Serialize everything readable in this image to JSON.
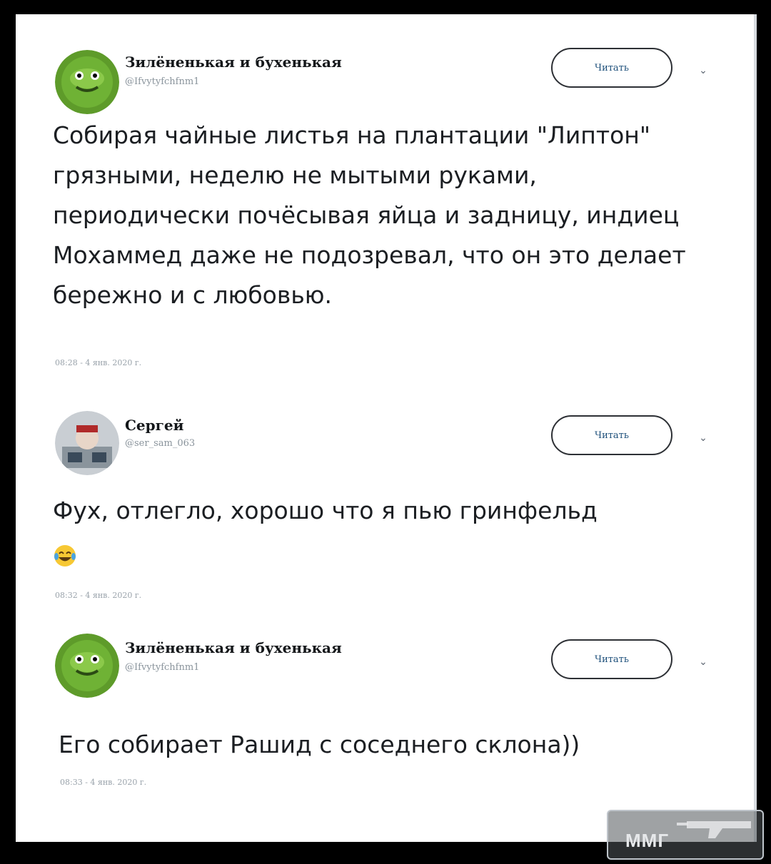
{
  "tweets": [
    {
      "author_name": "Зилёненькая и бухенькая",
      "author_handle": "@Ifvytyfchfnm1",
      "follow_label": "Читать",
      "text": "Собирая чайные листья на плантации \"Липтон\" грязными, неделю не мытыми руками, периодически почёсывая яйца и задницу, индиец Мохаммед даже не подозревал, что он это делает бережно и с любовью.",
      "timestamp": "08:28 - 4 янв. 2020 г."
    },
    {
      "author_name": "Сергей",
      "author_handle": "@ser_sam_063",
      "follow_label": "Читать",
      "text": "Фух, отлегло, хорошо что я пью гринфельд",
      "emoji": "tears-of-joy-emoji",
      "timestamp": "08:32 - 4 янв. 2020 г."
    },
    {
      "author_name": "Зилёненькая и бухенькая",
      "author_handle": "@Ifvytyfchfnm1",
      "follow_label": "Читать",
      "text": "Его собирает Рашид с соседнего склона))",
      "timestamp": "08:33 - 4 янв. 2020 г."
    }
  ],
  "watermark": {
    "text": "ММГ"
  },
  "colors": {
    "page_bg": "#000000",
    "card_bg": "#ffffff",
    "text": "#1b1e22",
    "muted": "#8a949c"
  }
}
